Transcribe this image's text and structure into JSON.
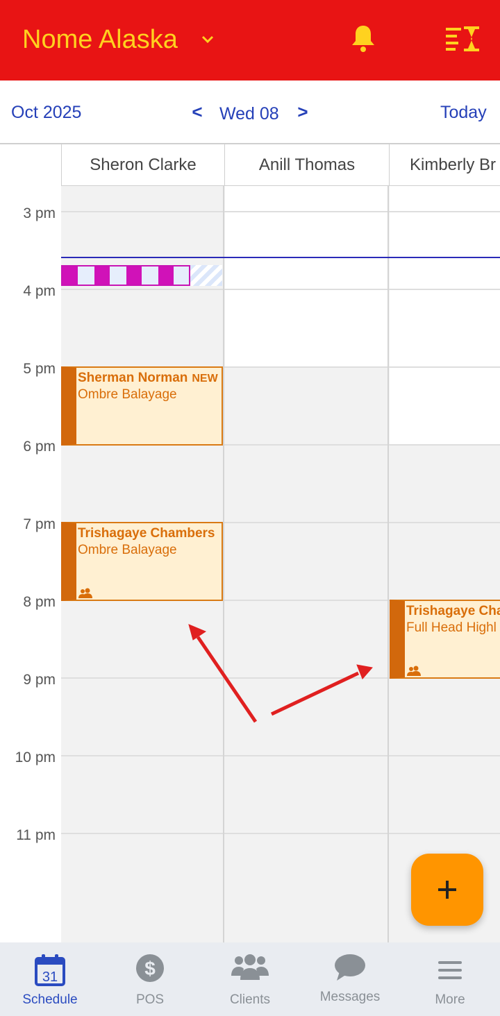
{
  "header": {
    "location": "Nome Alaska",
    "icons": {
      "dropdown": "chevron-down-icon",
      "notifications": "bell-icon",
      "waitlist": "waitlist-hourglass-icon"
    },
    "colors": {
      "background": "#e81414",
      "accent": "#ffd21f"
    }
  },
  "datebar": {
    "month": "Oct 2025",
    "prev": "<",
    "day": "Wed 08",
    "next": ">",
    "today": "Today"
  },
  "staff": [
    "Sheron Clarke",
    "Anill Thomas",
    "Kimberly Br"
  ],
  "times": [
    "3 pm",
    "4 pm",
    "5 pm",
    "6 pm",
    "7 pm",
    "8 pm",
    "9 pm",
    "10 pm",
    "11 pm"
  ],
  "appointments": [
    {
      "staff": "Sheron Clarke",
      "client": "Sherman Norman",
      "badge": "NEW",
      "service": "Ombre Balayage",
      "start": "5 pm",
      "end": "6 pm",
      "group": false
    },
    {
      "staff": "Sheron Clarke",
      "client": "Trishagaye Chambers",
      "service": "Ombre Balayage",
      "start": "7 pm",
      "end": "8 pm",
      "group": true
    },
    {
      "staff": "Kimberly Br",
      "client": "Trishagaye Cha",
      "service": "Full Head Highl",
      "start": "8 pm",
      "end": "9 pm",
      "group": true
    }
  ],
  "blocked_time": {
    "staff": "Sheron Clarke",
    "color": "#d012b8"
  },
  "fab": {
    "icon": "plus-icon",
    "color": "#ff9500"
  },
  "nav": {
    "items": [
      {
        "label": "Schedule",
        "icon": "calendar-icon",
        "calendar_day": "31",
        "active": true
      },
      {
        "label": "POS",
        "icon": "dollar-icon",
        "active": false
      },
      {
        "label": "Clients",
        "icon": "people-icon",
        "active": false
      },
      {
        "label": "Messages",
        "icon": "chat-icon",
        "active": false
      },
      {
        "label": "More",
        "icon": "menu-icon",
        "active": false
      }
    ],
    "active_color": "#2a4bc0"
  }
}
